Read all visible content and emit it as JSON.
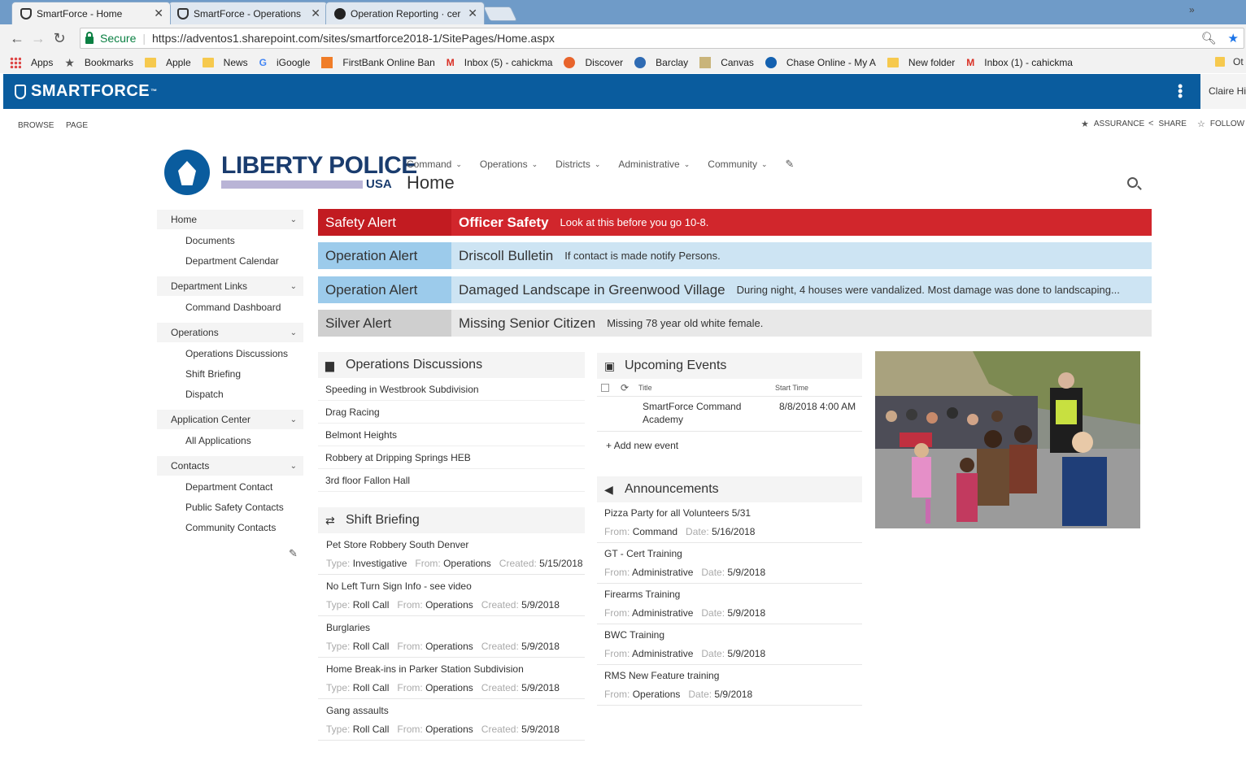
{
  "browser": {
    "tabs": [
      {
        "title": "SmartForce - Home",
        "active": true,
        "icon": "shield-icon"
      },
      {
        "title": "SmartForce - Operations",
        "active": false,
        "icon": "shield-icon"
      },
      {
        "title": "Operation Reporting · cer",
        "active": false,
        "icon": "github-icon"
      }
    ],
    "secure_label": "Secure",
    "url": "https://adventos1.sharepoint.com/sites/smartforce2018-1/SitePages/Home.aspx",
    "bookmarks": [
      {
        "label": "Apps",
        "icon": "apps-grid-icon"
      },
      {
        "label": "Bookmarks",
        "icon": "star-icon"
      },
      {
        "label": "Apple",
        "icon": "folder-icon"
      },
      {
        "label": "News",
        "icon": "folder-icon"
      },
      {
        "label": "iGoogle",
        "icon": "google-icon"
      },
      {
        "label": "FirstBank Online Ban",
        "icon": "bank-icon"
      },
      {
        "label": "Inbox (5) - cahickma",
        "icon": "gmail-icon"
      },
      {
        "label": "Discover",
        "icon": "discover-icon"
      },
      {
        "label": "Barclay",
        "icon": "barclay-icon"
      },
      {
        "label": "Canvas",
        "icon": "canvas-icon"
      },
      {
        "label": "Chase Online - My A",
        "icon": "chase-icon"
      },
      {
        "label": "New folder",
        "icon": "folder-icon"
      },
      {
        "label": "Inbox (1) - cahickma",
        "icon": "gmail-icon"
      }
    ],
    "bookmarks_overflow": "»",
    "bookmarks_trailing": "Ot"
  },
  "suite": {
    "brand": "SMARTFORCE",
    "trademark": "™",
    "user": "Claire Hic"
  },
  "ribbon": {
    "tabs": [
      "BROWSE",
      "PAGE"
    ],
    "actions": [
      "ASSURANCE",
      "SHARE",
      "FOLLOW"
    ]
  },
  "site": {
    "logo_text": "LIBERTY POLICE",
    "logo_sub": "USA",
    "nav": [
      "Command",
      "Operations",
      "Districts",
      "Administrative",
      "Community"
    ],
    "page_title": "Home"
  },
  "leftnav": [
    {
      "heading": "Home",
      "items": [
        "Documents",
        "Department Calendar"
      ]
    },
    {
      "heading": "Department Links",
      "items": [
        "Command Dashboard"
      ]
    },
    {
      "heading": "Operations",
      "items": [
        "Operations Discussions",
        "Shift Briefing",
        "Dispatch"
      ]
    },
    {
      "heading": "Application Center",
      "items": [
        "All Applications"
      ]
    },
    {
      "heading": "Contacts",
      "items": [
        "Department Contact",
        "Public Safety Contacts",
        "Community Contacts"
      ]
    }
  ],
  "alerts": [
    {
      "type": "Safety Alert",
      "title": "Officer Safety",
      "desc": "Look at this before you go 10-8.",
      "style": "red"
    },
    {
      "type": "Operation Alert",
      "title": "Driscoll Bulletin",
      "desc": "If contact is made notify Persons.",
      "style": "blue"
    },
    {
      "type": "Operation Alert",
      "title": "Damaged Landscape in Greenwood Village",
      "desc": "During night, 4 houses were vandalized. Most damage was done to landscaping...",
      "style": "blue"
    },
    {
      "type": "Silver Alert",
      "title": "Missing Senior Citizen",
      "desc": "Missing 78 year old white female.",
      "style": "gray"
    }
  ],
  "discussions": {
    "title": "Operations Discussions",
    "items": [
      "Speeding in Westbrook Subdivision",
      "Drag Racing",
      "Belmont Heights",
      "Robbery at Dripping Springs HEB",
      "3rd floor Fallon Hall"
    ]
  },
  "briefing": {
    "title": "Shift Briefing",
    "labels": {
      "type": "Type:",
      "from": "From:",
      "created": "Created:"
    },
    "items": [
      {
        "title": "Pet Store Robbery South Denver",
        "type": "Investigative",
        "from": "Operations",
        "created": "5/15/2018"
      },
      {
        "title": "No Left Turn Sign Info - see video",
        "type": "Roll Call",
        "from": "Operations",
        "created": "5/9/2018"
      },
      {
        "title": "Burglaries",
        "type": "Roll Call",
        "from": "Operations",
        "created": "5/9/2018"
      },
      {
        "title": "Home Break-ins in Parker Station Subdivision",
        "type": "Roll Call",
        "from": "Operations",
        "created": "5/9/2018"
      },
      {
        "title": "Gang assaults",
        "type": "Roll Call",
        "from": "Operations",
        "created": "5/9/2018"
      }
    ]
  },
  "events": {
    "title": "Upcoming Events",
    "col_title": "Title",
    "col_start": "Start Time",
    "rows": [
      {
        "title": "SmartForce Command Academy",
        "start": "8/8/2018 4:00 AM"
      }
    ],
    "add_label": "Add new event"
  },
  "announcements": {
    "title": "Announcements",
    "labels": {
      "from": "From:",
      "date": "Date:"
    },
    "items": [
      {
        "title": "Pizza Party for all Volunteers 5/31",
        "from": "Command",
        "date": "5/16/2018"
      },
      {
        "title": "GT - Cert Training",
        "from": "Administrative",
        "date": "5/9/2018"
      },
      {
        "title": "Firearms Training",
        "from": "Administrative",
        "date": "5/9/2018"
      },
      {
        "title": "BWC Training",
        "from": "Administrative",
        "date": "5/9/2018"
      },
      {
        "title": "RMS New Feature training",
        "from": "Operations",
        "date": "5/9/2018"
      }
    ]
  }
}
